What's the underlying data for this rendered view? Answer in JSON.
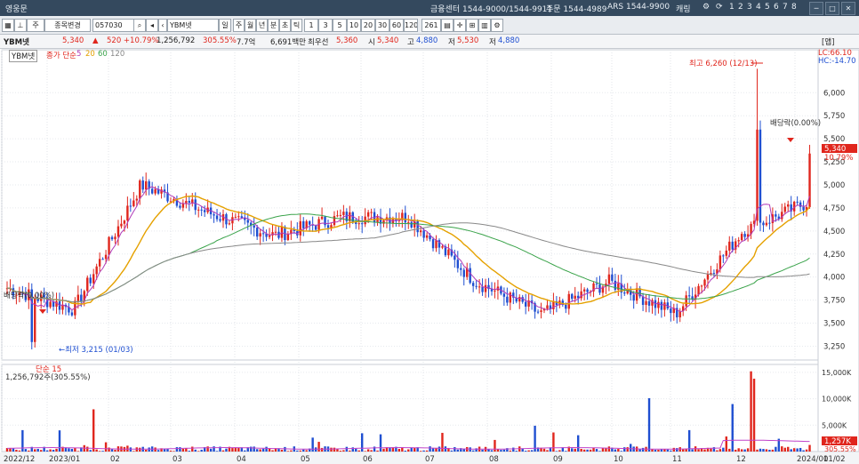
{
  "window": {
    "title": "영웅문",
    "center_info": "금융센터 1544-9000/1544-9911",
    "order_info": "주문 1544-4989",
    "ars_info": "ARS 1544-9900",
    "menu_label": "캐링",
    "page_numbers": [
      "1",
      "2",
      "3",
      "4",
      "5",
      "6",
      "7",
      "8"
    ]
  },
  "toolbar": {
    "mode": "주",
    "search_label": "종목변경",
    "code": "057030",
    "name": "YBM넷",
    "type_label": "일",
    "periods": [
      "주",
      "월",
      "년",
      "분",
      "초",
      "틱"
    ],
    "minute_options": [
      "1",
      "3",
      "5",
      "10",
      "20",
      "30",
      "60",
      "120"
    ],
    "count": "261"
  },
  "info": {
    "stock": "YBM넷",
    "price": "5,340",
    "change": "520 +10.79%",
    "volume": "1,256,792",
    "volume_ratio": "305.55%",
    "amount": "7.7억",
    "amount2": "6,691백만",
    "credit_label": "최우선",
    "best_price": "5,360",
    "open_label": "시",
    "open": "5,340",
    "high_label": "고",
    "high": "4,880",
    "low_label": "저",
    "low": "5,530",
    "close_extra": "4,880",
    "panel_label": "[앱]"
  },
  "legend": {
    "stock": "YBM넷",
    "ma_label": "종가 단순",
    "ma_periods": [
      "5",
      "20",
      "60",
      "120"
    ],
    "lc": "LC:66.10",
    "hc": "HC:-14.70"
  },
  "annotations": {
    "high": "최고 6,260 (12/13)",
    "low": "최저 3,215 (01/03)",
    "dividend_top": "배당락(0.00%)",
    "dividend_left": "배당락(0.00%)",
    "price_tag": "5,340",
    "pct_tag": "10.79%",
    "volume_title": "단순 15",
    "volume_info": "1,256,792주(305.55%)",
    "volume_tag": "1,257K",
    "volume_pct_tag": "305.55%"
  },
  "colors": {
    "up": "#e0261d",
    "down": "#1f4fd1",
    "ma5": "#b03ab8",
    "ma20": "#e5a100",
    "ma60": "#3aa34a",
    "ma120": "#888888"
  },
  "chart_data": {
    "type": "candlestick",
    "y_ticks": [
      6000,
      5750,
      5500,
      5250,
      5000,
      4750,
      4500,
      4250,
      4000,
      3750,
      3500,
      3250
    ],
    "y_range": [
      3100,
      6350
    ],
    "x_labels": [
      "2022/12",
      "2023/01",
      "02",
      "03",
      "04",
      "05",
      "06",
      "07",
      "08",
      "09",
      "10",
      "11",
      "12",
      "2024/01",
      "01/02"
    ],
    "volume_ticks": [
      "15,000K",
      "10,000K",
      "5,000K"
    ],
    "volume_range": [
      0,
      16500
    ],
    "monthly_closes": [
      {
        "month": "2022/12",
        "close": 3880
      },
      {
        "month": "2023/01",
        "close": 3650
      },
      {
        "month": "02",
        "close": 5000
      },
      {
        "month": "03",
        "close": 4700
      },
      {
        "month": "04",
        "close": 4450
      },
      {
        "month": "05",
        "close": 4650
      },
      {
        "month": "06",
        "close": 4650
      },
      {
        "month": "07",
        "close": 3950
      },
      {
        "month": "08",
        "close": 3600
      },
      {
        "month": "09",
        "close": 3950
      },
      {
        "month": "10",
        "close": 3600
      },
      {
        "month": "11",
        "close": 4500
      },
      {
        "month": "12",
        "close": 4820
      }
    ],
    "high": 6260,
    "low": 3215,
    "last_close": 5340
  }
}
